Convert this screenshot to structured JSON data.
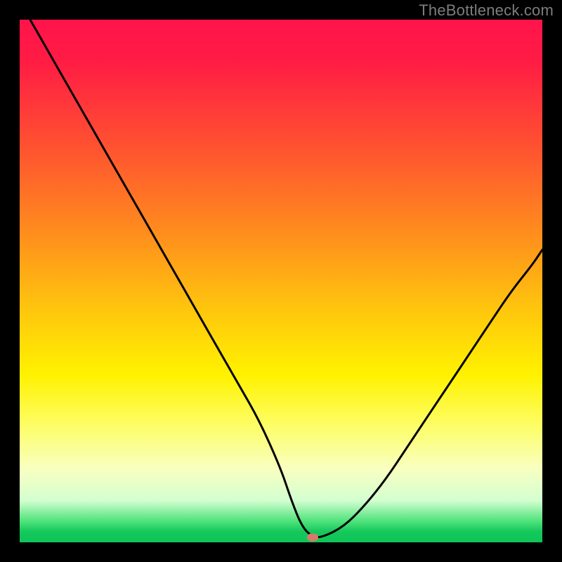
{
  "watermark": "TheBottleneck.com",
  "chart_data": {
    "type": "line",
    "title": "",
    "xlabel": "",
    "ylabel": "",
    "xlim": [
      0,
      100
    ],
    "ylim": [
      0,
      100
    ],
    "grid": false,
    "legend": false,
    "background": "rainbow-vertical-red-to-green",
    "series": [
      {
        "name": "bottleneck-curve",
        "x": [
          2,
          6,
          10,
          14,
          18,
          22,
          26,
          30,
          34,
          38,
          42,
          46,
          50,
          52,
          54,
          56,
          58,
          62,
          66,
          70,
          74,
          78,
          82,
          86,
          90,
          94,
          98,
          100
        ],
        "y": [
          100,
          93,
          86,
          79,
          72,
          65,
          58,
          51,
          44,
          37,
          30,
          23,
          14,
          8,
          3,
          1,
          1,
          3,
          7,
          12,
          18,
          24,
          30,
          36,
          42,
          48,
          53,
          56
        ]
      }
    ],
    "marker": {
      "x": 56,
      "y": 1,
      "color": "#d77a6a"
    }
  }
}
